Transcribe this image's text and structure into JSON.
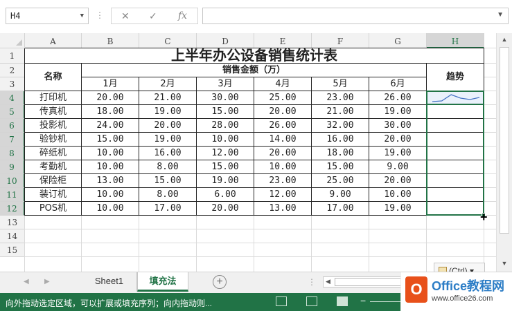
{
  "formula_bar": {
    "name_box": "H4",
    "dots": "⋮",
    "cancel_icon": "✕",
    "enter_icon": "✓",
    "fx_label": "fx",
    "formula": ""
  },
  "columns": [
    "A",
    "B",
    "C",
    "D",
    "E",
    "F",
    "G",
    "H"
  ],
  "rows": [
    "1",
    "2",
    "3",
    "4",
    "5",
    "6",
    "7",
    "8",
    "9",
    "10",
    "11",
    "12",
    "13",
    "14",
    "15"
  ],
  "table": {
    "title": "上半年办公设备销售统计表",
    "name_header": "名称",
    "amount_header": "销售金额（万）",
    "trend_header": "趋势",
    "months": [
      "1月",
      "2月",
      "3月",
      "4月",
      "5月",
      "6月"
    ],
    "items": [
      {
        "name": "打印机",
        "values": [
          "20.00",
          "21.00",
          "30.00",
          "25.00",
          "23.00",
          "26.00"
        ]
      },
      {
        "name": "传真机",
        "values": [
          "18.00",
          "19.00",
          "15.00",
          "20.00",
          "21.00",
          "19.00"
        ]
      },
      {
        "name": "投影机",
        "values": [
          "24.00",
          "20.00",
          "28.00",
          "26.00",
          "32.00",
          "30.00"
        ]
      },
      {
        "name": "验钞机",
        "values": [
          "15.00",
          "19.00",
          "10.00",
          "14.00",
          "16.00",
          "20.00"
        ]
      },
      {
        "name": "碎纸机",
        "values": [
          "10.00",
          "16.00",
          "12.00",
          "20.00",
          "18.00",
          "19.00"
        ]
      },
      {
        "name": "考勤机",
        "values": [
          "10.00",
          "8.00",
          "15.00",
          "10.00",
          "15.00",
          "9.00"
        ]
      },
      {
        "name": "保险柜",
        "values": [
          "13.00",
          "15.00",
          "19.00",
          "23.00",
          "25.00",
          "20.00"
        ]
      },
      {
        "name": "装订机",
        "values": [
          "10.00",
          "8.00",
          "6.00",
          "12.00",
          "9.00",
          "10.00"
        ]
      },
      {
        "name": "POS机",
        "values": [
          "10.00",
          "17.00",
          "20.00",
          "13.00",
          "17.00",
          "19.00"
        ]
      }
    ]
  },
  "sparkline": {
    "values": [
      20,
      21,
      30,
      25,
      23,
      26
    ],
    "color": "#4472c4"
  },
  "paste_options": "(Ctrl)",
  "sheet_tabs": [
    "Sheet1",
    "填充法"
  ],
  "active_sheet": 1,
  "status_message": "向外拖动选定区域，可以扩展或填充序列；向内拖动则...",
  "watermark": {
    "brand": "Office教程网",
    "url": "www.office26.com"
  },
  "colors": {
    "accent": "#217346",
    "selection_fill": "#eaf1fb"
  }
}
